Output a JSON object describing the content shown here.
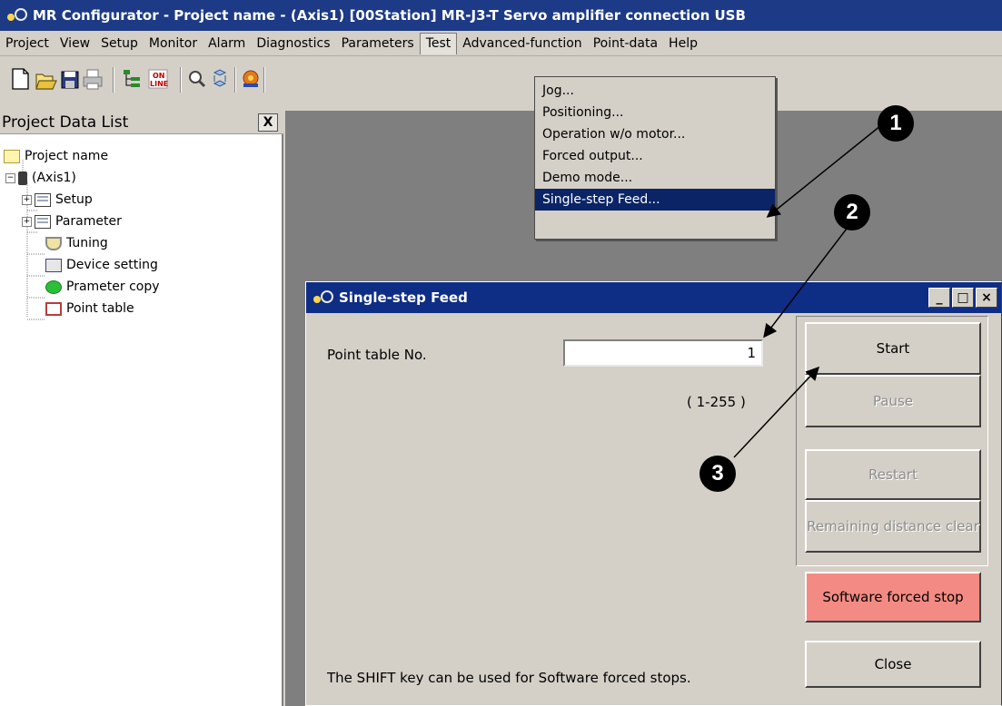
{
  "window": {
    "title": "MR Configurator - Project name - (Axis1)   [00Station]   MR-J3-T   Servo amplifier connection USB"
  },
  "menu": [
    "Project",
    "View",
    "Setup",
    "Monitor",
    "Alarm",
    "Diagnostics",
    "Parameters",
    "Test",
    "Advanced-function",
    "Point-data",
    "Help"
  ],
  "test_menu": {
    "items": [
      "Jog...",
      "Positioning...",
      "Operation w/o motor...",
      "Forced output...",
      "Demo mode...",
      "Single-step Feed..."
    ],
    "selected": "Single-step Feed..."
  },
  "toolbar": {
    "icons": [
      "new-icon",
      "open-icon",
      "save-icon",
      "print-icon",
      "tree-icon",
      "online-icon",
      "search-icon",
      "convert-icon",
      "settings-icon",
      "graph-icon",
      "tuning-icon",
      "zoom-icon"
    ],
    "online_text": "ON\nLINE"
  },
  "project_panel": {
    "title": "Project Data List",
    "close_label": "X",
    "tree": {
      "root": "Project name",
      "axis": "(Axis1)",
      "children": [
        "Setup",
        "Parameter",
        "Tuning",
        "Device setting",
        "Prameter copy",
        "Point table"
      ]
    }
  },
  "dialog": {
    "title": "Single-step Feed",
    "point_table_label": "Point table No.",
    "point_table_value": "1",
    "range_label": "( 1-255 )",
    "buttons": {
      "start": "Start",
      "pause": "Pause",
      "restart": "Restart",
      "remaining": "Remaining distance clear",
      "stop": "Software forced stop",
      "close": "Close"
    },
    "hint": "The SHIFT key can be used for Software forced stops."
  },
  "callouts": [
    "1",
    "2",
    "3"
  ],
  "colors": {
    "title_bar": "#1c3a86",
    "dialog_title": "#0e2d85",
    "menu_highlight": "#0a2466",
    "stop_button": "#f38b84",
    "workspace": "#7f7f7f"
  }
}
